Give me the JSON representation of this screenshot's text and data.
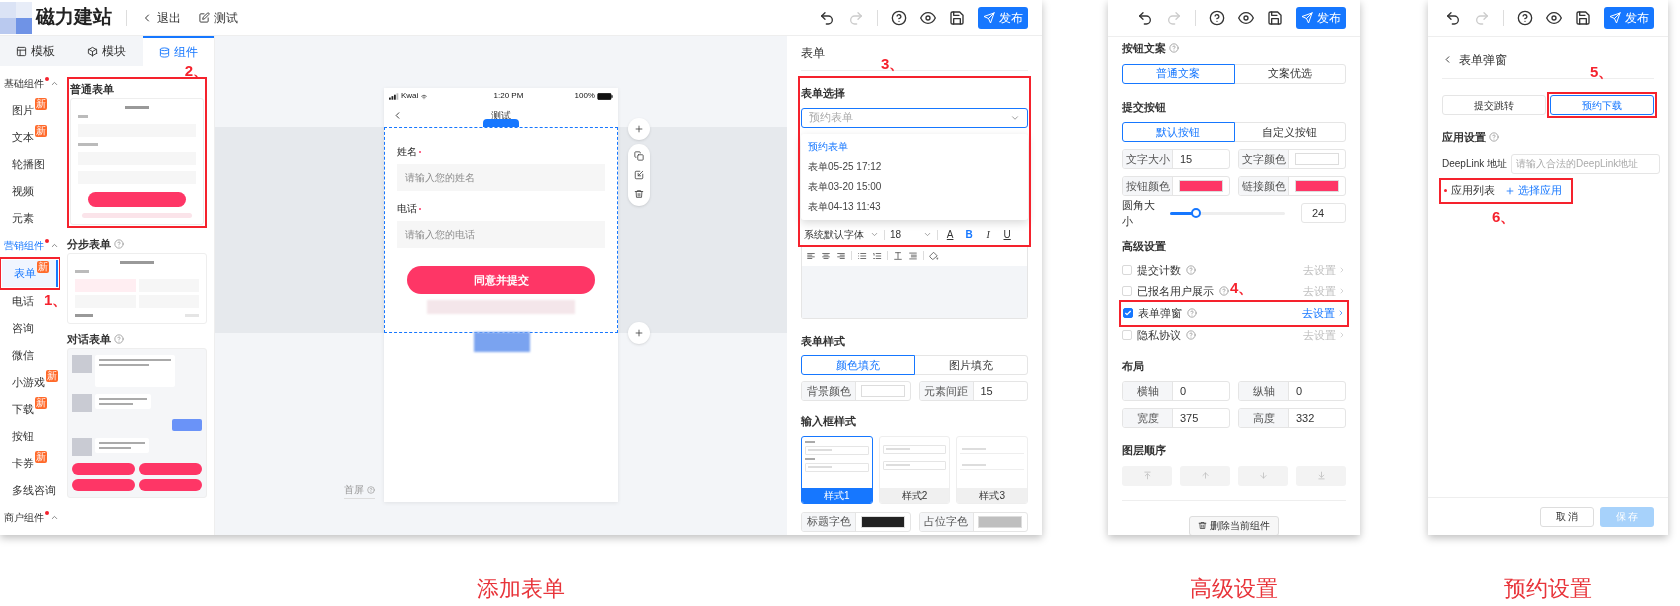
{
  "editor": {
    "site_name": "磁力建站",
    "header_actions": [
      {
        "label": "退出"
      },
      {
        "label": "测试"
      }
    ],
    "publish": "发布",
    "panel_tabs": [
      {
        "label": "模板",
        "selected": false
      },
      {
        "label": "模块",
        "selected": false
      },
      {
        "label": "组件",
        "selected": true
      }
    ],
    "categories": [
      {
        "title": "基础组件",
        "active": false,
        "items": [
          {
            "label": "图片",
            "badge": "新",
            "selected": false
          },
          {
            "label": "文本",
            "badge": "新",
            "selected": false
          },
          {
            "label": "轮播图",
            "selected": false
          },
          {
            "label": "视频",
            "selected": false
          },
          {
            "label": "元素",
            "selected": false
          }
        ]
      },
      {
        "title": "营销组件",
        "active": true,
        "items": [
          {
            "label": "表单",
            "badge": "新",
            "selected": true,
            "callout": "1、"
          },
          {
            "label": "电话",
            "selected": false
          },
          {
            "label": "咨询",
            "selected": false
          },
          {
            "label": "微信",
            "selected": false
          },
          {
            "label": "小游戏",
            "badge": "新",
            "selected": false
          },
          {
            "label": "下载",
            "badge": "新",
            "selected": false
          },
          {
            "label": "按钮",
            "selected": false
          },
          {
            "label": "卡券",
            "badge": "新",
            "selected": false
          },
          {
            "label": "多线咨询",
            "selected": false
          }
        ]
      },
      {
        "title": "商户组件",
        "active": false
      }
    ],
    "component_cards": [
      {
        "kind": "basic",
        "title": "普通表单",
        "help": false,
        "callout": "2、"
      },
      {
        "kind": "steps",
        "title": "分步表单",
        "help": true
      },
      {
        "kind": "chat",
        "title": "对话表单",
        "help": true
      }
    ],
    "canvas": {
      "status_bar": {
        "carrier": "Kwai",
        "time": "1:20 PM",
        "battery": "100%"
      },
      "page_title": "测试",
      "form": {
        "fields": [
          {
            "label": "姓名",
            "required": true,
            "placeholder": "请输入您的姓名"
          },
          {
            "label": "电话",
            "required": true,
            "placeholder": "请输入您的电话"
          }
        ],
        "submit": "同意并提交"
      },
      "screen_label": "首屏"
    },
    "properties": {
      "title": "表单",
      "form_select": {
        "label": "表单选择",
        "value": "预约表单",
        "callout": "3、",
        "options": [
          {
            "label": "预约表单",
            "selected": true
          },
          {
            "label": "表单05-25 17:12",
            "selected": false
          },
          {
            "label": "表单03-20 15:00",
            "selected": false
          },
          {
            "label": "表单04-13 11:43",
            "selected": false
          }
        ]
      },
      "text_toolbar": {
        "font": "系统默认字体",
        "size": "18",
        "formats": [
          {
            "glyph": "A",
            "kind": "color",
            "on": false
          },
          {
            "glyph": "B",
            "kind": "bold",
            "on": true
          },
          {
            "glyph": "I",
            "kind": "italic",
            "on": false
          },
          {
            "glyph": "U",
            "kind": "underline",
            "on": false
          }
        ]
      },
      "form_style": {
        "label": "表单样式",
        "options": [
          {
            "label": "颜色填充",
            "selected": true
          },
          {
            "label": "图片填充",
            "selected": false
          }
        ],
        "fields": [
          {
            "label": "背景颜色",
            "kind": "swatch",
            "color": "#ffffff"
          },
          {
            "label": "元素间距",
            "kind": "value",
            "value": "15"
          }
        ]
      },
      "input_style": {
        "label": "输入框样式",
        "styles": [
          {
            "label": "样式1",
            "kind": "labeled",
            "selected": true
          },
          {
            "label": "样式2",
            "kind": "boxed",
            "selected": false
          },
          {
            "label": "样式3",
            "kind": "underlined",
            "selected": false
          }
        ],
        "fields": [
          {
            "label": "标题字色",
            "kind": "swatch",
            "color": "#222222"
          },
          {
            "label": "占位字色",
            "kind": "swatch",
            "color": "#bfbfbf"
          }
        ]
      }
    }
  },
  "advanced_panel": {
    "publish": "发布",
    "button_copy": {
      "label": "按钮文案",
      "help": true,
      "options": [
        {
          "label": "普通文案",
          "selected": true
        },
        {
          "label": "文案优选",
          "selected": false
        }
      ]
    },
    "submit_button": {
      "label": "提交按钮",
      "options": [
        {
          "label": "默认按钮",
          "selected": true
        },
        {
          "label": "自定义按钮",
          "selected": false
        }
      ],
      "fields": [
        {
          "label": "文字大小",
          "kind": "value",
          "value": "15"
        },
        {
          "label": "文字颜色",
          "kind": "swatch",
          "color": "#ffffff"
        },
        {
          "label": "按钮颜色",
          "kind": "swatch",
          "color": "#fe3666"
        },
        {
          "label": "链接颜色",
          "kind": "swatch",
          "color": "#fe3666"
        }
      ],
      "radius": {
        "label": "圆角大小",
        "level": 0.23,
        "value": "24"
      }
    },
    "advanced": {
      "label": "高级设置",
      "options": [
        {
          "label": "提交计数",
          "help": true,
          "checked": false,
          "link": "去设置"
        },
        {
          "label": "已报名用户展示",
          "help": true,
          "checked": false,
          "link": "去设置"
        },
        {
          "label": "表单弹窗",
          "help": true,
          "checked": true,
          "link": "去设置",
          "callout": "4、"
        },
        {
          "label": "隐私协议",
          "help": true,
          "checked": false,
          "link": "去设置"
        }
      ]
    },
    "layout": {
      "label": "布局",
      "fields": [
        {
          "label": "横轴",
          "value": "0"
        },
        {
          "label": "纵轴",
          "value": "0"
        },
        {
          "label": "宽度",
          "value": "375"
        },
        {
          "label": "高度",
          "value": "332"
        }
      ]
    },
    "layer_order": {
      "label": "图层顺序",
      "buttons": [
        {
          "kind": "top"
        },
        {
          "kind": "up"
        },
        {
          "kind": "down"
        },
        {
          "kind": "bottom"
        }
      ]
    },
    "delete": "删除当前组件"
  },
  "popup_panel": {
    "publish": "发布",
    "title": "表单弹窗",
    "modes": [
      {
        "label": "提交跳转",
        "selected": false
      },
      {
        "label": "预约下载",
        "selected": true,
        "callout": "5、"
      }
    ],
    "app_settings": {
      "label": "应用设置",
      "help": true,
      "deeplink": {
        "label": "DeepLink 地址",
        "placeholder": "请输入合法的DeepLink地址"
      },
      "app_list": {
        "label": "应用列表",
        "required": true,
        "action": "选择应用",
        "callout": "6、"
      }
    },
    "cancel": "取 消",
    "save": {
      "label": "保 存",
      "disabled": true
    }
  },
  "captions": [
    "添加表单",
    "高级设置",
    "预约设置"
  ]
}
